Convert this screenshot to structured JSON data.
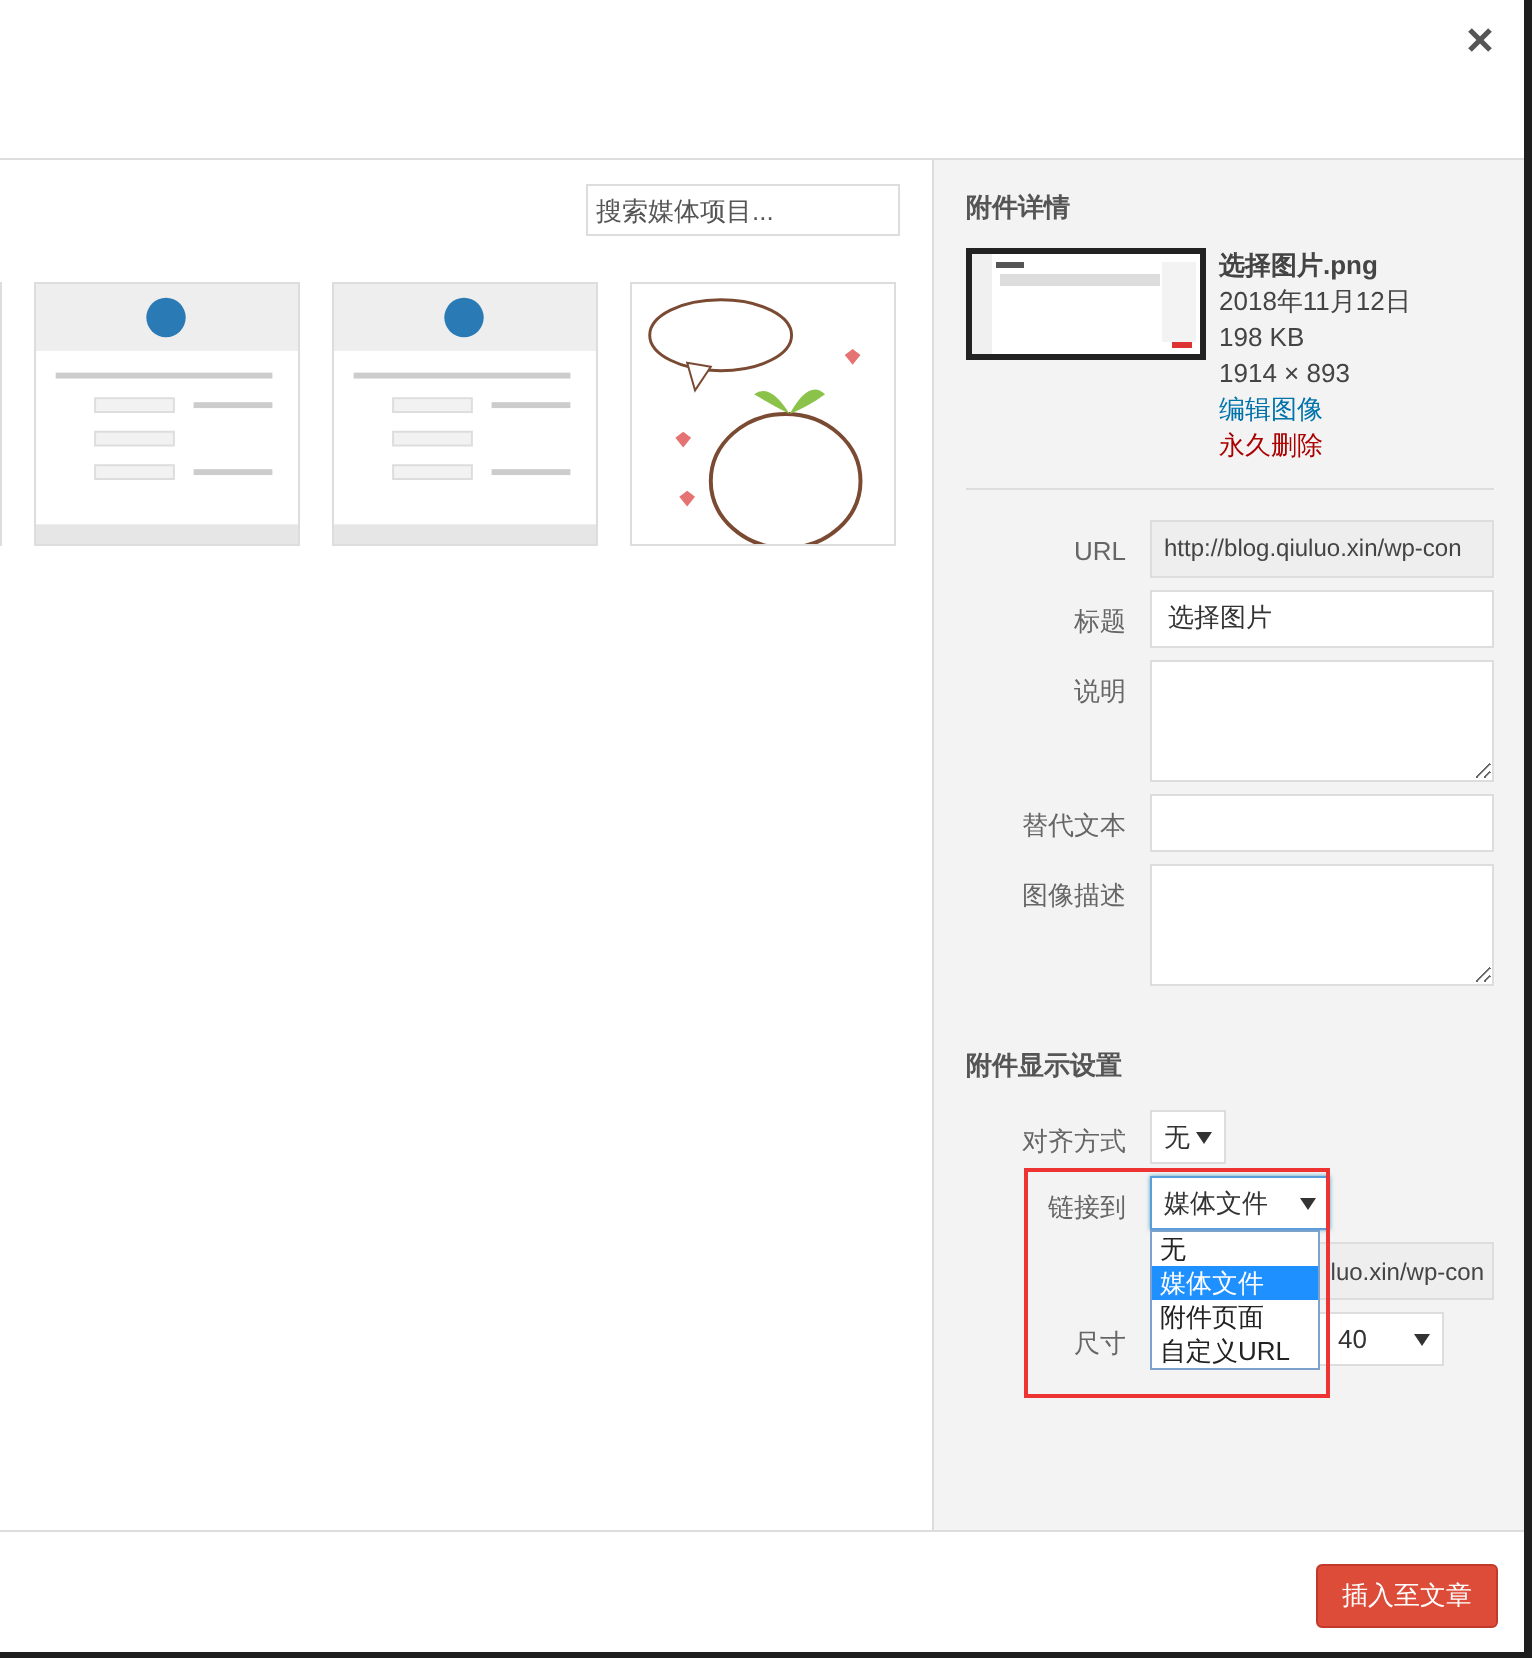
{
  "search": {
    "placeholder": "搜索媒体项目..."
  },
  "details": {
    "heading": "附件详情",
    "filename": "选择图片.png",
    "date": "2018年11月12日",
    "size": "198 KB",
    "dimensions": "1914 × 893",
    "edit_link": "编辑图像",
    "delete_link": "永久删除"
  },
  "fields": [
    {
      "label": "URL",
      "kind": "readonly",
      "value": "http://blog.qiuluo.xin/wp-con"
    },
    {
      "label": "标题",
      "kind": "input",
      "value": "选择图片"
    },
    {
      "label": "说明",
      "kind": "textarea"
    },
    {
      "label": "替代文本",
      "kind": "input"
    },
    {
      "label": "图像描述",
      "kind": "textarea"
    }
  ],
  "display_settings": {
    "heading": "附件显示设置",
    "alignment": {
      "label": "对齐方式",
      "value": "无"
    },
    "link_to": {
      "label": "链接到",
      "value": "媒体文件",
      "expanded": true,
      "options": [
        {
          "label": "无",
          "selected": false
        },
        {
          "label": "媒体文件",
          "selected": true
        },
        {
          "label": "附件页面",
          "selected": false
        },
        {
          "label": "自定义URL",
          "selected": false
        }
      ]
    },
    "link_url": {
      "value": "luo.xin/wp-con"
    },
    "size": {
      "label": "尺寸",
      "value": "40"
    },
    "highlight": true
  },
  "insert_button": "插入至文章"
}
